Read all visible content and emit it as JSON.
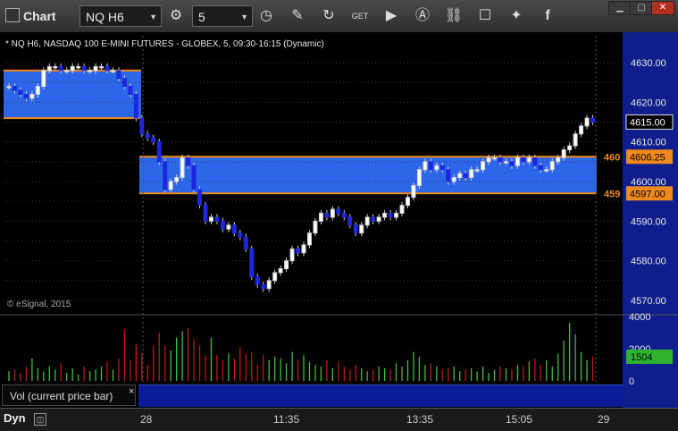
{
  "toolbar": {
    "title": "Chart",
    "symbol": "NQ H6",
    "interval": "5",
    "buttons": [
      "settings-icon",
      "clock-icon",
      "pencil-icon",
      "refresh-icon",
      "get-icon",
      "play-icon",
      "alert-icon",
      "link-icon",
      "comment-icon",
      "twitter-icon",
      "facebook-icon"
    ]
  },
  "chart": {
    "header": "* NQ H6, NASDAQ 100 E-MINI FUTURES - GLOBEX, 5, 09:30-16:15 (Dynamic)",
    "copyright": "© eSignal, 2015",
    "price_ticks": [
      "4630.00",
      "4620.00",
      "4610.00",
      "4600.00",
      "4590.00",
      "4580.00",
      "4570.00"
    ],
    "last_price": "4615.00",
    "upper_level": "4606.25",
    "lower_level": "4597.00",
    "upper_level_tag": "460",
    "lower_level_tag": "459",
    "vol_ticks": [
      "4000",
      "2000",
      "0"
    ],
    "vol_last": "1504",
    "time_ticks": [
      "28",
      "11:35",
      "13:35",
      "15:05",
      "29"
    ]
  },
  "indicator": {
    "legend": "Vol (current price bar)",
    "close": "×"
  },
  "bottom": {
    "dyn": "Dyn",
    "dyn_button": "◫"
  },
  "chart_data": {
    "type": "candlestick",
    "symbol": "NQ H6",
    "interval": "5",
    "price_axis": [
      4570,
      4630
    ],
    "volume_axis": [
      0,
      4000
    ],
    "levels": [
      4606.25,
      4597.0
    ],
    "last_price": 4615.0,
    "last_volume": 1504,
    "prices": [
      4624,
      4623,
      4622,
      4621,
      4622,
      4624,
      4628,
      4629,
      4629,
      4628,
      4628,
      4629,
      4629,
      4628,
      4628,
      4629,
      4629,
      4628,
      4628,
      4626,
      4624,
      4622,
      4616,
      4612,
      4611,
      4610,
      4605,
      4598,
      4600,
      4601,
      4606,
      4604,
      4598,
      4594,
      4590,
      4591,
      4590,
      4588,
      4589,
      4587,
      4586,
      4583,
      4576,
      4574,
      4573,
      4575,
      4577,
      4578,
      4580,
      4583,
      4582,
      4584,
      4587,
      4590,
      4592,
      4591,
      4593,
      4592,
      4591,
      4589,
      4587,
      4589,
      4591,
      4590,
      4591,
      4592,
      4591,
      4592,
      4594,
      4596,
      4599,
      4603,
      4605,
      4603,
      4604,
      4603,
      4600,
      4601,
      4602,
      4601,
      4603,
      4603,
      4605,
      4606,
      4606,
      4605,
      4605,
      4604,
      4606,
      4605,
      4606,
      4604,
      4603,
      4603,
      4605,
      4606,
      4608,
      4609,
      4612,
      4614,
      4616,
      4615
    ],
    "volumes": [
      600,
      700,
      500,
      900,
      1400,
      800,
      600,
      900,
      700,
      1100,
      500,
      800,
      400,
      900,
      600,
      700,
      900,
      1200,
      700,
      1400,
      3200,
      1300,
      2300,
      1700,
      1000,
      2200,
      3000,
      2200,
      1900,
      2700,
      3100,
      3300,
      2600,
      2200,
      1600,
      2700,
      1600,
      1300,
      1700,
      1400,
      2100,
      1700,
      1800,
      1000,
      1600,
      1300,
      1500,
      1400,
      1100,
      1800,
      1300,
      1600,
      1200,
      1000,
      900,
      1300,
      800,
      1200,
      900,
      700,
      1000,
      800,
      600,
      700,
      900,
      800,
      700,
      1100,
      900,
      1300,
      1800,
      1500,
      1000,
      1100,
      900,
      700,
      800,
      900,
      600,
      700,
      800,
      600,
      900,
      500,
      700,
      900,
      800,
      700,
      1000,
      900,
      1200,
      1400,
      1000,
      1300,
      900,
      1700,
      2500,
      3600,
      2900,
      1800,
      1300,
      1504
    ]
  }
}
